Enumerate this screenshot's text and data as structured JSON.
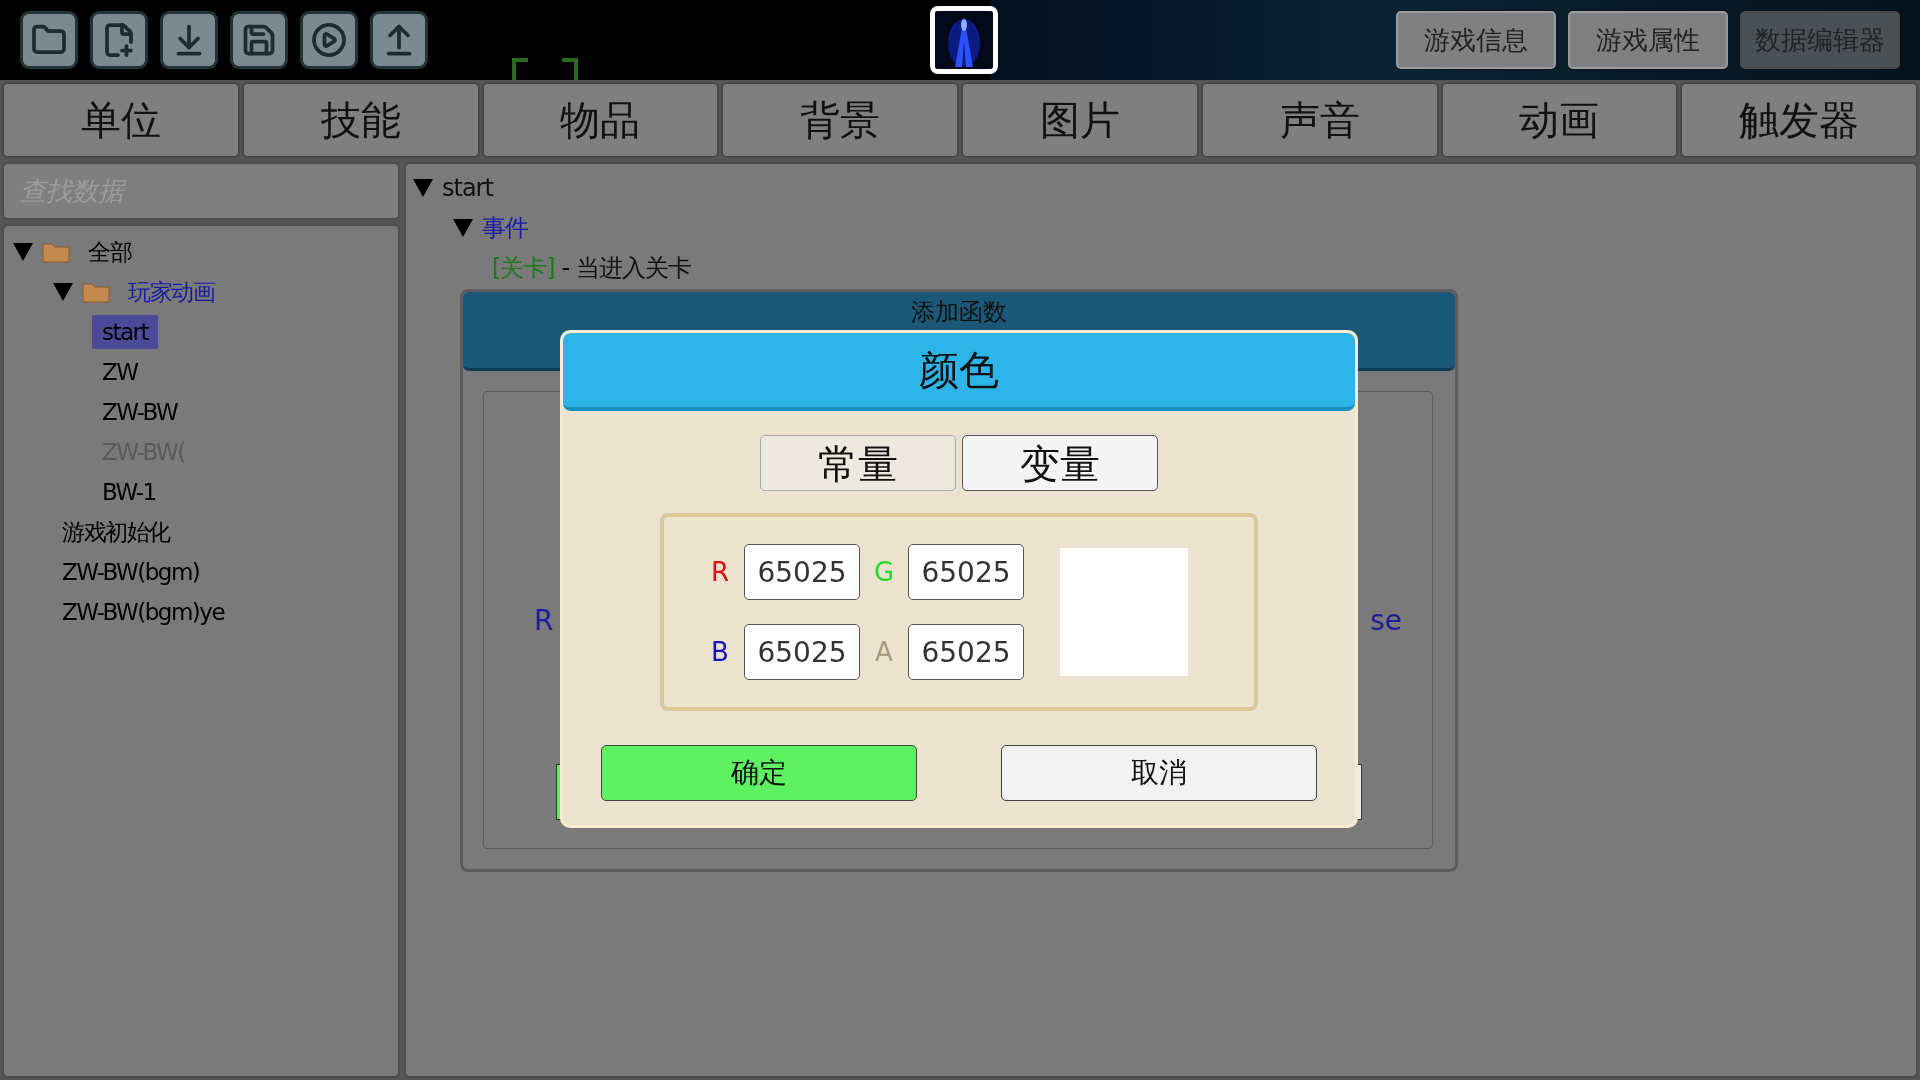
{
  "top_buttons": [
    {
      "label": "游戏信息",
      "selected": false
    },
    {
      "label": "游戏属性",
      "selected": false
    },
    {
      "label": "数据编辑器",
      "selected": true
    }
  ],
  "tabs": [
    {
      "label": "单位"
    },
    {
      "label": "技能"
    },
    {
      "label": "物品"
    },
    {
      "label": "背景"
    },
    {
      "label": "图片"
    },
    {
      "label": "声音"
    },
    {
      "label": "动画"
    },
    {
      "label": "触发器"
    }
  ],
  "search": {
    "placeholder": "查找数据"
  },
  "tree": [
    {
      "kind": "folder",
      "label": "全部",
      "color": "#000000",
      "expanded": true,
      "children": [
        {
          "kind": "folder",
          "label": "玩家动画",
          "color": "#1a1aa8",
          "expanded": true,
          "children": [
            {
              "kind": "item",
              "label": "start",
              "selected": true,
              "disabled": false
            },
            {
              "kind": "item",
              "label": "ZW",
              "selected": false,
              "disabled": false
            },
            {
              "kind": "item",
              "label": "ZW-BW",
              "selected": false,
              "disabled": false
            },
            {
              "kind": "item",
              "label": "ZW-BW(",
              "selected": false,
              "disabled": true
            },
            {
              "kind": "item",
              "label": "BW-1",
              "selected": false,
              "disabled": false
            }
          ]
        },
        {
          "kind": "item",
          "label": "游戏初始化",
          "selected": false,
          "disabled": false
        },
        {
          "kind": "item",
          "label": "ZW-BW(bgm)",
          "selected": false,
          "disabled": false
        },
        {
          "kind": "item",
          "label": "ZW-BW(bgm)ye",
          "selected": false,
          "disabled": false
        }
      ]
    }
  ],
  "editor": {
    "root": "start",
    "section": "事件",
    "event": {
      "category": "[关卡]",
      "text": "- 当进入关卡"
    }
  },
  "back_dialog": {
    "title": "添加函数",
    "left_fragment": "R",
    "right_fragment": "se"
  },
  "color_dialog": {
    "title": "颜色",
    "modes": [
      {
        "label": "常量",
        "selected": true
      },
      {
        "label": "变量",
        "selected": false
      }
    ],
    "channels": [
      {
        "label": "R",
        "color": "#e01010",
        "value": "65025"
      },
      {
        "label": "G",
        "color": "#22dd22",
        "value": "65025"
      },
      {
        "label": "B",
        "color": "#1515c0",
        "value": "65025"
      },
      {
        "label": "A",
        "color": "#a89a7e",
        "value": "65025"
      }
    ],
    "preview": {
      "color": "#ffffff"
    },
    "buttons": [
      {
        "kind": "confirm",
        "label": "确定"
      },
      {
        "kind": "cancel",
        "label": "取消"
      }
    ]
  }
}
